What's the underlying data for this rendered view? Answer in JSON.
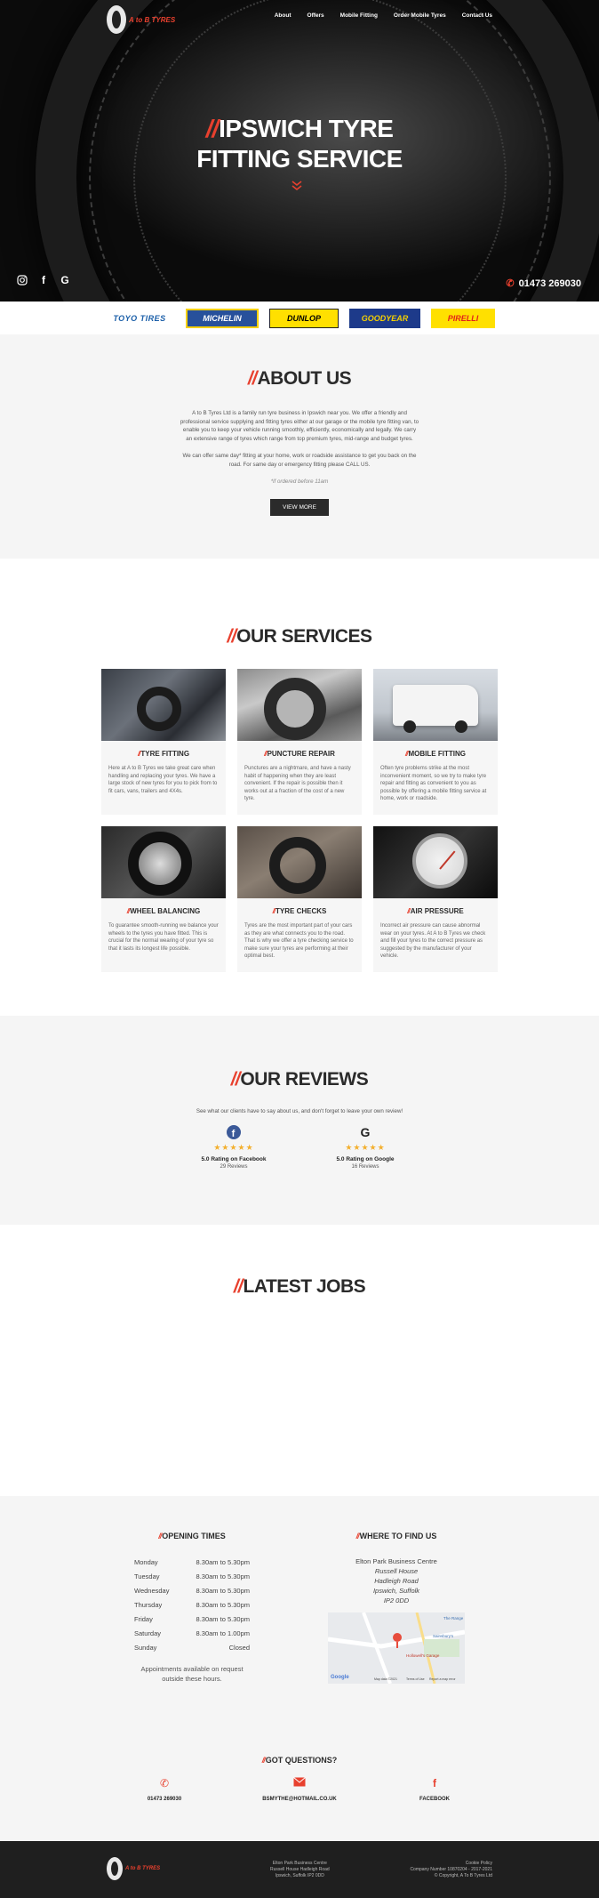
{
  "nav": {
    "logo_text": "A to B TYRES",
    "items": [
      "About",
      "Offers",
      "Mobile Fitting",
      "Order Mobile Tyres",
      "Contact Us"
    ]
  },
  "hero": {
    "title_line1": "IPSWICH TYRE",
    "title_line2": "FITTING SERVICE",
    "phone": "01473 269030",
    "social_icons": [
      "instagram-icon",
      "facebook-icon",
      "google-icon"
    ]
  },
  "brands": [
    "TOYO TIRES",
    "MICHELIN",
    "DUNLOP",
    "GOODYEAR",
    "PIRELLI"
  ],
  "about": {
    "title": "ABOUT US",
    "p1": "A to B Tyres Ltd is a family run tyre business in Ipswich near you. We offer a friendly and professional service supplying and fitting tyres either at our garage or the mobile tyre fitting van, to enable you to keep your vehicle running smoothly, efficiently, economically and legally. We carry an extensive range of tyres which range from top premium tyres, mid-range and budget tyres.",
    "p2": "We can offer same day* fitting at your home, work or roadside assistance to get you back on the road. For same day or emergency fitting please CALL US.",
    "note": "*if ordered before 11am",
    "button": "VIEW MORE"
  },
  "services": {
    "title": "OUR SERVICES",
    "cards": [
      {
        "title": "TYRE FITTING",
        "text": "Here at A to B Tyres we take great care when handling and replacing your tyres. We have a large stock of new tyres for you to pick from to fit cars, vans, trailers and 4X4s."
      },
      {
        "title": "PUNCTURE REPAIR",
        "text": "Punctures are a nightmare, and have a nasty habit of happening when they are least convenient. If the repair is possible then it works out at a fraction of the cost of a new tyre."
      },
      {
        "title": "MOBILE FITTING",
        "text": "Often tyre problems strike at the most inconvenient moment, so we try to make tyre repair and fitting as convenient to you as possible by offering a mobile fitting service at home, work or roadside."
      },
      {
        "title": "WHEEL BALANCING",
        "text": "To guarantee smooth-running we balance your wheels to the tyres you have fitted. This is crucial for the normal wearing of your tyre so that it lasts its longest life possible."
      },
      {
        "title": "TYRE CHECKS",
        "text": "Tyres are the most important part of your cars as they are what connects you to the road. That is why we offer a tyre checking service to make sure your tyres are performing at their optimal best."
      },
      {
        "title": "AIR PRESSURE",
        "text": "Incorrect air pressure can cause abnormal wear on your tyres. At A to B Tyres we check and fill your tyres to the correct pressure as suggested by the manufacturer of your vehicle."
      }
    ]
  },
  "reviews": {
    "title": "OUR REVIEWS",
    "subtitle": "See what our clients have to say about us, and don't forget to leave your own review!",
    "items": [
      {
        "icon": "facebook-icon",
        "stars": "★★★★★",
        "rating": "5.0 Rating on Facebook",
        "count": "29 Reviews"
      },
      {
        "icon": "google-icon",
        "stars": "★★★★★",
        "rating": "5.0 Rating on Google",
        "count": "16 Reviews"
      }
    ]
  },
  "jobs": {
    "title": "LATEST JOBS"
  },
  "opening": {
    "title": "OPENING TIMES",
    "rows": [
      {
        "day": "Monday",
        "time": "8.30am to 5.30pm"
      },
      {
        "day": "Tuesday",
        "time": "8.30am to 5.30pm"
      },
      {
        "day": "Wednesday",
        "time": "8.30am to 5.30pm"
      },
      {
        "day": "Thursday",
        "time": "8.30am to 5.30pm"
      },
      {
        "day": "Friday",
        "time": "8.30am to 5.30pm"
      },
      {
        "day": "Saturday",
        "time": "8.30am to 1.00pm"
      },
      {
        "day": "Sunday",
        "time": "Closed"
      }
    ],
    "note_line1": "Appointments available on request",
    "note_line2": "outside these hours."
  },
  "find": {
    "title": "WHERE TO FIND US",
    "address": [
      "Elton Park Business Centre",
      "Russell House",
      "Hadleigh Road",
      "Ipswich, Suffolk",
      "IP2 0DD"
    ],
    "map_labels": {
      "road": "The Range",
      "store1": "Sainsbury's",
      "store2": "Hollowell's Garage",
      "brand": "Google",
      "credits": "Map data ©2021",
      "terms": "Terms of Use",
      "report": "Report a map error"
    }
  },
  "questions": {
    "title": "GOT QUESTIONS?",
    "items": [
      {
        "icon": "phone-icon",
        "label": "01473 269030"
      },
      {
        "icon": "email-icon",
        "label": "BSMYTHE@HOTMAIL.CO.UK"
      },
      {
        "icon": "facebook-icon",
        "label": "FACEBOOK"
      }
    ]
  },
  "footer": {
    "address": [
      "Elton Park Business Centre",
      "Russell House Hadleigh Road",
      "Ipswich, Suffolk IP2 0DD"
    ],
    "right": [
      "Cookie Policy",
      "Company Number 10870204 - 2017-2021",
      "© Copyright, A To B Tyres Ltd"
    ]
  },
  "colors": {
    "accent": "#e8402e",
    "dark": "#2b2b2b",
    "light_bg": "#f5f5f5",
    "footer_bg": "#1f1f1f"
  }
}
